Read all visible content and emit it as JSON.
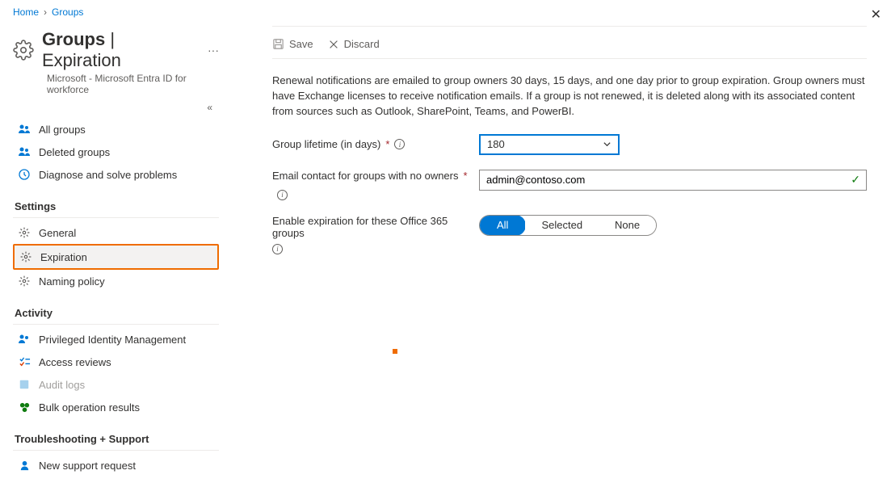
{
  "breadcrumb": {
    "home": "Home",
    "groups": "Groups"
  },
  "header": {
    "title_bold": "Groups",
    "title_sep": " | ",
    "title_light": "Expiration",
    "subtitle": "Microsoft - Microsoft Entra ID for workforce"
  },
  "sidebar": {
    "items": [
      {
        "label": "All groups"
      },
      {
        "label": "Deleted groups"
      },
      {
        "label": "Diagnose and solve problems"
      }
    ],
    "settings_header": "Settings",
    "settings": [
      {
        "label": "General"
      },
      {
        "label": "Expiration"
      },
      {
        "label": "Naming policy"
      }
    ],
    "activity_header": "Activity",
    "activity": [
      {
        "label": "Privileged Identity Management"
      },
      {
        "label": "Access reviews"
      },
      {
        "label": "Audit logs"
      },
      {
        "label": "Bulk operation results"
      }
    ],
    "troubleshoot_header": "Troubleshooting + Support",
    "troubleshoot": [
      {
        "label": "New support request"
      }
    ]
  },
  "toolbar": {
    "save": "Save",
    "discard": "Discard"
  },
  "description": "Renewal notifications are emailed to group owners 30 days, 15 days, and one day prior to group expiration. Group owners must have Exchange licenses to receive notification emails. If a group is not renewed, it is deleted along with its associated content from sources such as Outlook, SharePoint, Teams, and PowerBI.",
  "form": {
    "lifetime_label": "Group lifetime (in days)",
    "lifetime_value": "180",
    "email_label": "Email contact for groups with no owners",
    "email_value": "admin@contoso.com",
    "enable_label": "Enable expiration for these Office 365 groups",
    "pill_all": "All",
    "pill_selected": "Selected",
    "pill_none": "None"
  }
}
